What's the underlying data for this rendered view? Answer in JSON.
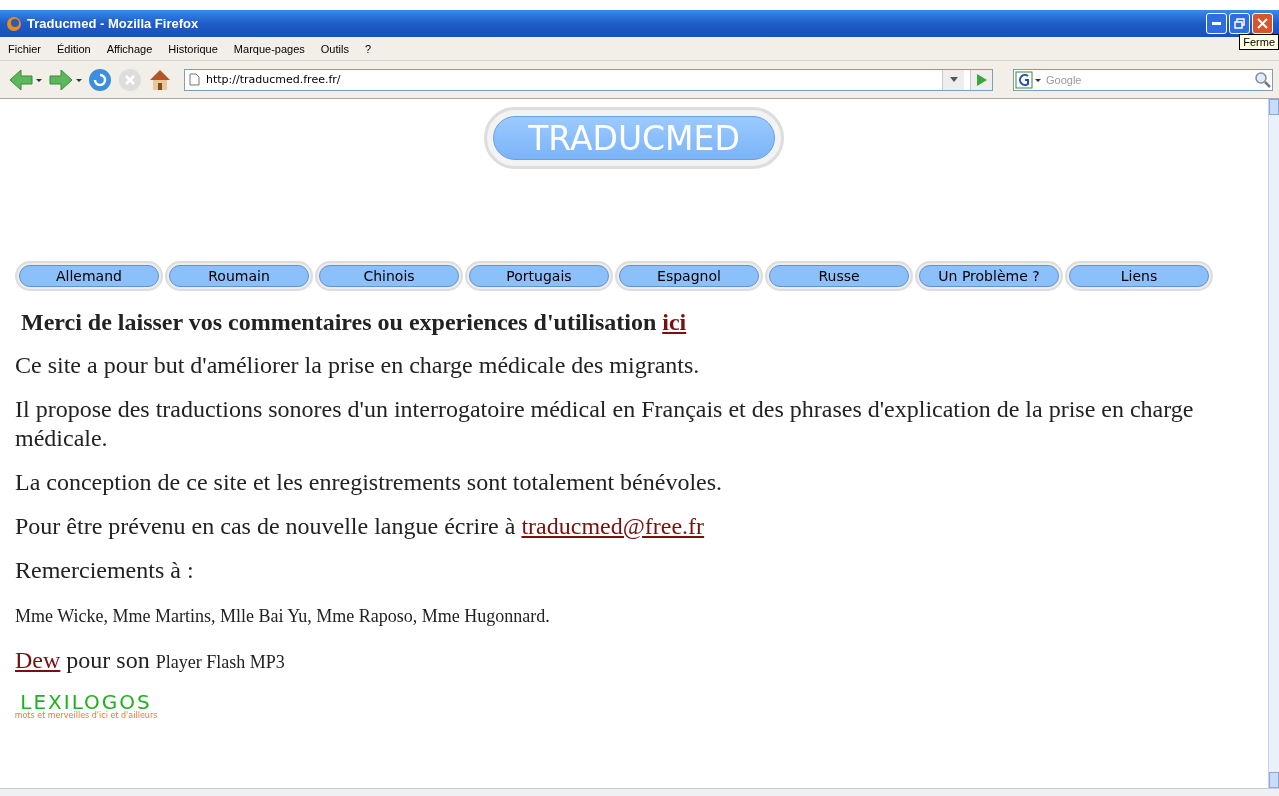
{
  "window": {
    "title": "Traducmed - Mozilla Firefox",
    "tooltip": "Ferme"
  },
  "menu": [
    "Fichier",
    "Édition",
    "Affichage",
    "Historique",
    "Marque-pages",
    "Outils",
    "?"
  ],
  "toolbar": {
    "url": "http://traducmed.free.fr/",
    "search_placeholder": "Google"
  },
  "page": {
    "logo": "TRADUCMED",
    "nav": [
      "Allemand",
      "Roumain",
      "Chinois",
      "Portugais",
      "Espagnol",
      "Russe",
      "Un Problème ?",
      "Liens"
    ],
    "heading": [
      {
        "kind": "text",
        "text": "Merci de laisser vos commentaires ou experiences d'utilisation "
      },
      {
        "kind": "link",
        "text": "ici"
      }
    ],
    "paragraphs": [
      [
        {
          "kind": "text",
          "text": "Ce site a pour but d'améliorer la prise en charge médicale des migrants."
        }
      ],
      [
        {
          "kind": "text",
          "text": "Il propose des traductions sonores d'un interrogatoire médical en Français et des phrases d'explication de la prise en charge médicale."
        }
      ],
      [
        {
          "kind": "text",
          "text": "La conception de ce site et les enregistrements sont totalement bénévoles."
        }
      ],
      [
        {
          "kind": "text",
          "text": "Pour être prévenu en cas de nouvelle langue écrire à "
        },
        {
          "kind": "link",
          "text": "traducmed@free.fr"
        }
      ],
      [
        {
          "kind": "text",
          "text": "Remerciements à :"
        }
      ],
      [
        {
          "kind": "small",
          "text": "Mme Wicke, Mme Martins, Mlle Bai Yu, Mme Raposo, Mme Hugonnard."
        }
      ],
      [
        {
          "kind": "link",
          "text": "Dew"
        },
        {
          "kind": "text",
          "text": " pour son "
        },
        {
          "kind": "small",
          "text": "Player Flash MP3"
        }
      ]
    ],
    "badge": {
      "title": "LEXILOGOS",
      "tagline": "mots et merveilles d'ici et d'ailleurs"
    }
  }
}
